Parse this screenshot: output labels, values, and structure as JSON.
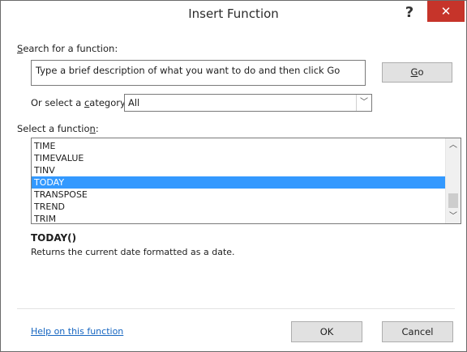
{
  "window": {
    "title": "Insert Function",
    "help_icon": "?",
    "close_icon": "✕"
  },
  "search": {
    "label_prefix": "",
    "label_access": "S",
    "label_rest": "earch for a function:",
    "value": "Type a brief description of what you want to do and then click Go",
    "go_access": "G",
    "go_rest": "o"
  },
  "category": {
    "label_pre": "Or select a ",
    "label_access": "c",
    "label_post": "ategory:",
    "selected": "All",
    "arrow_icon": "﹀"
  },
  "functions": {
    "label_pre": "Select a functio",
    "label_access": "n",
    "label_post": ":",
    "items": [
      "TIME",
      "TIMEVALUE",
      "TINV",
      "TODAY",
      "TRANSPOSE",
      "TREND",
      "TRIM"
    ],
    "selected_index": 3,
    "scroll_up_icon": "︿",
    "scroll_down_icon": "﹀"
  },
  "details": {
    "signature": "TODAY()",
    "description": "Returns the current date formatted as a date."
  },
  "footer": {
    "help_link": "Help on this function",
    "ok_label": "OK",
    "cancel_label": "Cancel"
  },
  "colors": {
    "selection": "#3399ff",
    "close_button": "#c6342a",
    "link": "#1565c0"
  }
}
